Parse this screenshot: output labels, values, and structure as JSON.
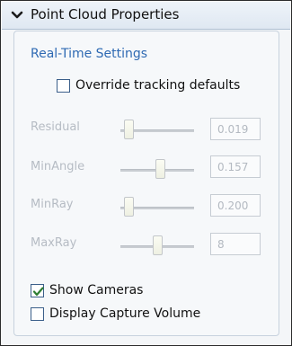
{
  "header": {
    "title": "Point Cloud Properties",
    "icon": "chevron-down-icon"
  },
  "realtime": {
    "group_title": "Real-Time Settings",
    "override": {
      "label": "Override tracking defaults",
      "checked": false
    }
  },
  "params": [
    {
      "label": "Residual",
      "value": "0.019",
      "slider_level": 0.05
    },
    {
      "label": "MinAngle",
      "value": "0.157",
      "slider_level": 0.55
    },
    {
      "label": "MinRay",
      "value": "0.200",
      "slider_level": 0.05
    },
    {
      "label": "MaxRay",
      "value": "8",
      "slider_level": 0.5
    }
  ],
  "display": {
    "show_cameras": {
      "label": "Show Cameras",
      "checked": true
    },
    "capture_volume": {
      "label": "Display Capture Volume",
      "checked": false
    }
  },
  "colors": {
    "group_title": "#2f6ab3",
    "checkmark": "#2e7d32",
    "disabled_text": "#b6bcc4"
  }
}
